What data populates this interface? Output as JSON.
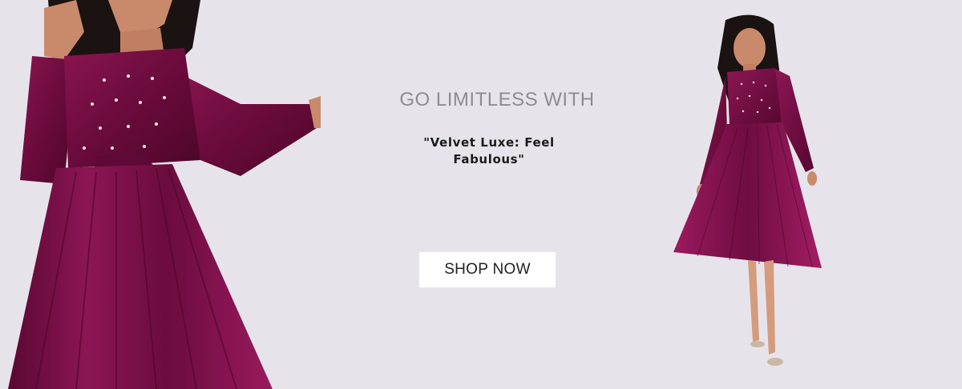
{
  "hero": {
    "headline": "GO LIMITLESS WITH",
    "tagline": "\"Velvet Luxe: Feel Fabulous\"",
    "cta_label": "SHOP NOW"
  },
  "colors": {
    "background": "#e6e4ea",
    "dress": "#7a0f44",
    "button_bg": "#ffffff"
  },
  "images": {
    "left": "model-closeup-velvet-dress-photo",
    "right": "model-full-length-velvet-dress-photo"
  }
}
